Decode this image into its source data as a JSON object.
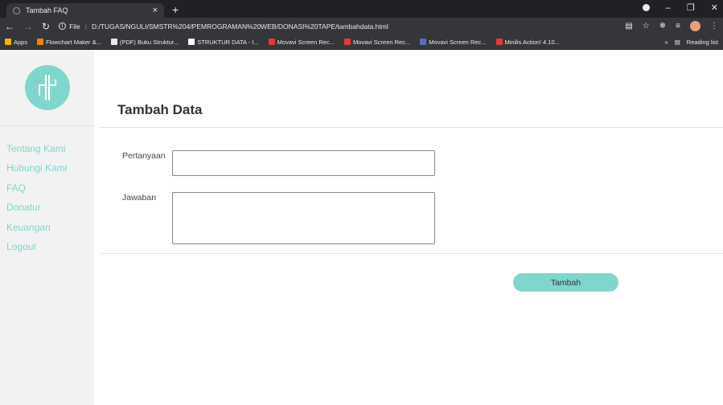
{
  "browser": {
    "tab_title": "Tambah FAQ",
    "tab_close": "×",
    "new_tab": "+",
    "url_label": "File",
    "url": "D:/TUGAS/NGULI/SMSTR%204/PEMROGRAMAN%20WEB/DONASI%20TAPE/tambahdata.html",
    "bookmarks": [
      {
        "label": "Apps",
        "color": "#f4b400"
      },
      {
        "label": "Flowchart Maker &...",
        "color": "#f08705"
      },
      {
        "label": "(PDF) Buku Struktur...",
        "color": "#e8eaed"
      },
      {
        "label": "STRUKTUR DATA - I...",
        "color": "#ffffff"
      },
      {
        "label": "Movavi Screen Rec...",
        "color": "#e53935"
      },
      {
        "label": "Movavi Screen Rec...",
        "color": "#e53935"
      },
      {
        "label": "Movavi Screen Rec...",
        "color": "#5c6bc0"
      },
      {
        "label": "Minilis Action! 4.10...",
        "color": "#e53935"
      }
    ],
    "more_bookmarks": "»",
    "reading_list": "Reading list"
  },
  "sidebar": {
    "menu": [
      "Tentang Kami",
      "Hubungi Kami",
      "FAQ",
      "Donatur",
      "Keuangan",
      "Logout"
    ]
  },
  "main": {
    "heading": "Tambah Data",
    "question_label": "Pertanyaan",
    "question_value": "",
    "answer_label": "Jawaban",
    "answer_value": "",
    "submit_label": "Tambah"
  },
  "colors": {
    "accent": "#7fd6cc",
    "sidebar_bg": "#f2f2f2"
  }
}
